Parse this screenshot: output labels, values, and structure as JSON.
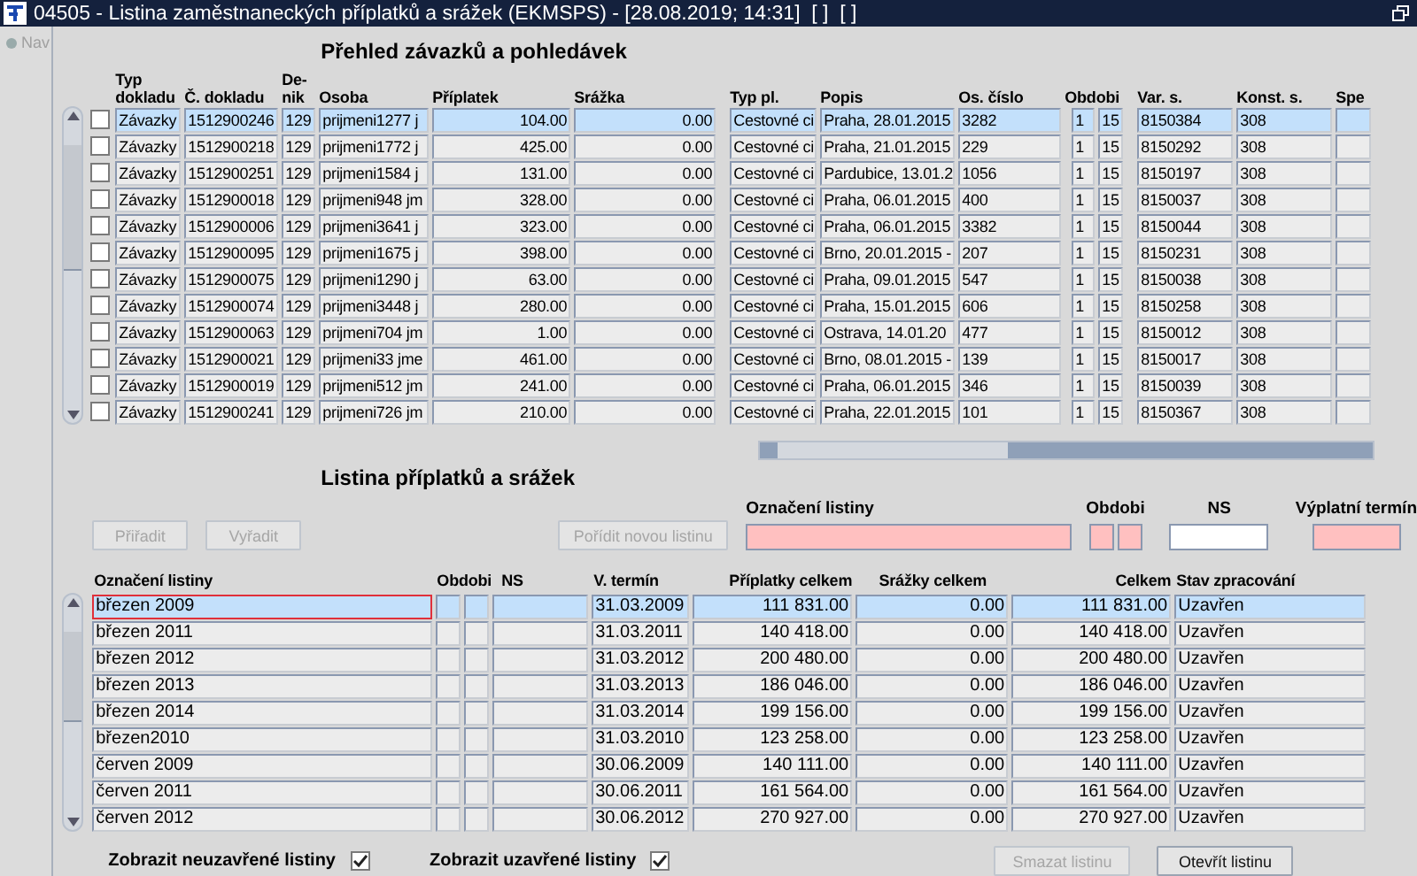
{
  "window": {
    "title": "04505 - Listina zaměstnaneckých příplatků a srážek (EKMSPS) - [28.08.2019; 14:31]  [ ]  [ ]"
  },
  "nav": {
    "label": "Nav",
    "disabled": true
  },
  "overview": {
    "title": "Přehled závazků a pohledávek",
    "columns": [
      "Typ dokladu",
      "Č. dokladu",
      "De-nik",
      "Osoba",
      "Příplatek",
      "Srážka",
      "Typ pl.",
      "Popis",
      "Os. číslo",
      "Obdobi",
      "Var. s.",
      "Konst. s.",
      "Spe"
    ],
    "rows": [
      {
        "checked": false,
        "selected": true,
        "cells": [
          "Závazky",
          "1512900246",
          "129",
          "prijmeni1277 j",
          "104.00",
          "0.00",
          "Cestovné ci",
          "Praha, 28.01.2015",
          "3282",
          [
            "1",
            "15"
          ],
          "8150384",
          "308"
        ]
      },
      {
        "checked": false,
        "selected": false,
        "cells": [
          "Závazky",
          "1512900218",
          "129",
          "prijmeni1772 j",
          "425.00",
          "0.00",
          "Cestovné ci",
          "Praha, 21.01.2015",
          "229",
          [
            "1",
            "15"
          ],
          "8150292",
          "308"
        ]
      },
      {
        "checked": false,
        "selected": false,
        "cells": [
          "Závazky",
          "1512900251",
          "129",
          "prijmeni1584 j",
          "131.00",
          "0.00",
          "Cestovné ci",
          "Pardubice, 13.01.2",
          "1056",
          [
            "1",
            "15"
          ],
          "8150197",
          "308"
        ]
      },
      {
        "checked": false,
        "selected": false,
        "cells": [
          "Závazky",
          "1512900018",
          "129",
          "prijmeni948 jm",
          "328.00",
          "0.00",
          "Cestovné ci",
          "Praha, 06.01.2015",
          "400",
          [
            "1",
            "15"
          ],
          "8150037",
          "308"
        ]
      },
      {
        "checked": false,
        "selected": false,
        "cells": [
          "Závazky",
          "1512900006",
          "129",
          "prijmeni3641 j",
          "323.00",
          "0.00",
          "Cestovné ci",
          "Praha, 06.01.2015",
          "3382",
          [
            "1",
            "15"
          ],
          "8150044",
          "308"
        ]
      },
      {
        "checked": false,
        "selected": false,
        "cells": [
          "Závazky",
          "1512900095",
          "129",
          "prijmeni1675 j",
          "398.00",
          "0.00",
          "Cestovné ci",
          "Brno, 20.01.2015 -",
          "207",
          [
            "1",
            "15"
          ],
          "8150231",
          "308"
        ]
      },
      {
        "checked": false,
        "selected": false,
        "cells": [
          "Závazky",
          "1512900075",
          "129",
          "prijmeni1290 j",
          "63.00",
          "0.00",
          "Cestovné ci",
          "Praha, 09.01.2015",
          "547",
          [
            "1",
            "15"
          ],
          "8150038",
          "308"
        ]
      },
      {
        "checked": false,
        "selected": false,
        "cells": [
          "Závazky",
          "1512900074",
          "129",
          "prijmeni3448 j",
          "280.00",
          "0.00",
          "Cestovné ci",
          "Praha, 15.01.2015",
          "606",
          [
            "1",
            "15"
          ],
          "8150258",
          "308"
        ]
      },
      {
        "checked": false,
        "selected": false,
        "cells": [
          "Závazky",
          "1512900063",
          "129",
          "prijmeni704 jm",
          "1.00",
          "0.00",
          "Cestovné ci",
          "Ostrava, 14.01.20",
          "477",
          [
            "1",
            "15"
          ],
          "8150012",
          "308"
        ]
      },
      {
        "checked": false,
        "selected": false,
        "cells": [
          "Závazky",
          "1512900021",
          "129",
          "prijmeni33 jme",
          "461.00",
          "0.00",
          "Cestovné ci",
          "Brno, 08.01.2015 -",
          "139",
          [
            "1",
            "15"
          ],
          "8150017",
          "308"
        ]
      },
      {
        "checked": false,
        "selected": false,
        "cells": [
          "Závazky",
          "1512900019",
          "129",
          "prijmeni512 jm",
          "241.00",
          "0.00",
          "Cestovné ci",
          "Praha, 06.01.2015",
          "346",
          [
            "1",
            "15"
          ],
          "8150039",
          "308"
        ]
      },
      {
        "checked": false,
        "selected": false,
        "cells": [
          "Závazky",
          "1512900241",
          "129",
          "prijmeni726 jm",
          "210.00",
          "0.00",
          "Cestovné ci",
          "Praha, 22.01.2015",
          "101",
          [
            "1",
            "15"
          ],
          "8150367",
          "308"
        ]
      }
    ]
  },
  "listing": {
    "title": "Listina příplatků a srážek",
    "buttons": [
      {
        "label": "Přiřadit",
        "disabled": true
      },
      {
        "label": "Vyřadit",
        "disabled": true
      },
      {
        "label": "Pořídit novou listinu",
        "disabled": true
      }
    ],
    "fields": [
      {
        "label": "Označení listiny",
        "required": true
      },
      {
        "label": "Obdobi",
        "required": true
      },
      {
        "label": "NS",
        "required": false
      },
      {
        "label": "Výplatní termín",
        "required": true
      }
    ],
    "columns": [
      "Označení listiny",
      "Obdobi",
      "NS",
      "V. termín",
      "Příplatky celkem",
      "Srážky celkem",
      "Celkem",
      "Stav zpracování"
    ],
    "rows": [
      {
        "selected": true,
        "cells": [
          "březen 2009",
          "",
          "",
          "31.03.2009",
          "111 831.00",
          "0.00",
          "111 831.00",
          "Uzavřen"
        ]
      },
      {
        "selected": false,
        "cells": [
          "březen 2011",
          "",
          "",
          "31.03.2011",
          "140 418.00",
          "0.00",
          "140 418.00",
          "Uzavřen"
        ]
      },
      {
        "selected": false,
        "cells": [
          "březen 2012",
          "",
          "",
          "31.03.2012",
          "200 480.00",
          "0.00",
          "200 480.00",
          "Uzavřen"
        ]
      },
      {
        "selected": false,
        "cells": [
          "březen 2013",
          "",
          "",
          "31.03.2013",
          "186 046.00",
          "0.00",
          "186 046.00",
          "Uzavřen"
        ]
      },
      {
        "selected": false,
        "cells": [
          "březen 2014",
          "",
          "",
          "31.03.2014",
          "199 156.00",
          "0.00",
          "199 156.00",
          "Uzavřen"
        ]
      },
      {
        "selected": false,
        "cells": [
          "březen2010",
          "",
          "",
          "31.03.2010",
          "123 258.00",
          "0.00",
          "123 258.00",
          "Uzavřen"
        ]
      },
      {
        "selected": false,
        "cells": [
          "červen 2009",
          "",
          "",
          "30.06.2009",
          "140 111.00",
          "0.00",
          "140 111.00",
          "Uzavřen"
        ]
      },
      {
        "selected": false,
        "cells": [
          "červen 2011",
          "",
          "",
          "30.06.2011",
          "161 564.00",
          "0.00",
          "161 564.00",
          "Uzavřen"
        ]
      },
      {
        "selected": false,
        "cells": [
          "červen 2012",
          "",
          "",
          "30.06.2012",
          "270 927.00",
          "0.00",
          "270 927.00",
          "Uzavřen"
        ]
      }
    ],
    "filters": [
      {
        "label": "Zobrazit neuzavřené listiny",
        "checked": true
      },
      {
        "label": "Zobrazit uzavřené listiny",
        "checked": true
      }
    ],
    "actions": [
      {
        "label": "Smazat listinu",
        "disabled": true
      },
      {
        "label": "Otevřít listinu",
        "disabled": false
      }
    ]
  }
}
